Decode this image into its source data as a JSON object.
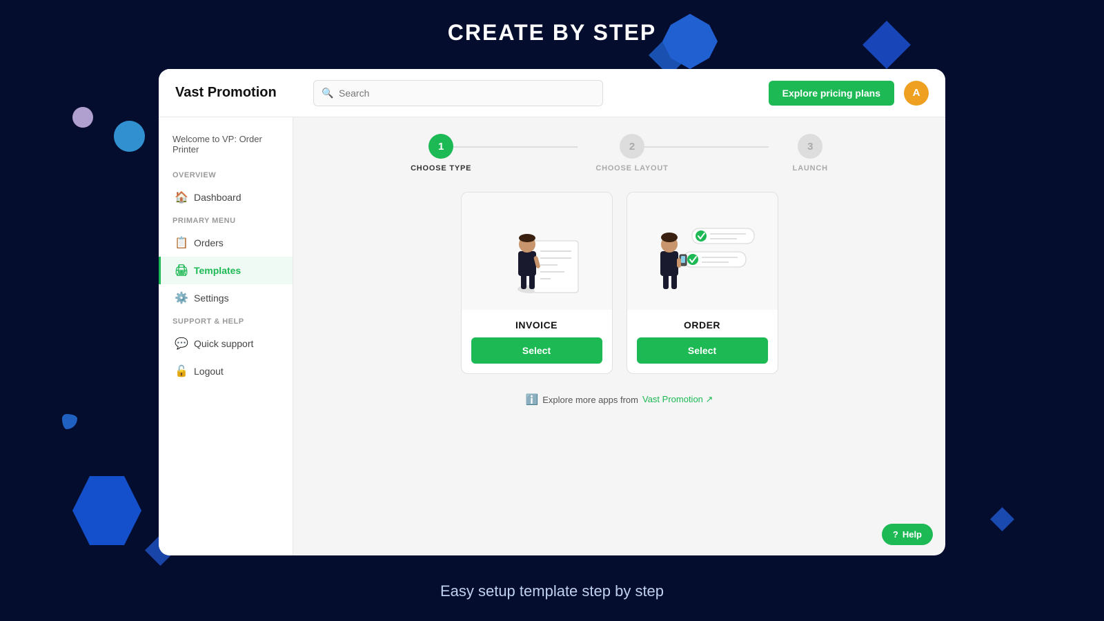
{
  "page": {
    "title": "CREATE BY STEP",
    "subtitle": "Easy setup template step by step",
    "background_color": "#050d2e"
  },
  "topbar": {
    "brand": "Vast Promotion",
    "search_placeholder": "Search",
    "explore_btn_label": "Explore pricing plans",
    "avatar_letter": "A"
  },
  "sidebar": {
    "welcome": "Welcome to VP: Order Printer",
    "sections": [
      {
        "label": "OVERVIEW",
        "items": [
          {
            "id": "dashboard",
            "label": "Dashboard",
            "icon": "🏠",
            "active": false
          }
        ]
      },
      {
        "label": "PRIMARY MENU",
        "items": [
          {
            "id": "orders",
            "label": "Orders",
            "icon": "📋",
            "active": false
          },
          {
            "id": "templates",
            "label": "Templates",
            "icon": "🖨",
            "active": true
          },
          {
            "id": "settings",
            "label": "Settings",
            "icon": "⚙️",
            "active": false
          }
        ]
      },
      {
        "label": "SUPPORT & HELP",
        "items": [
          {
            "id": "quick-support",
            "label": "Quick support",
            "icon": "💬",
            "active": false
          },
          {
            "id": "logout",
            "label": "Logout",
            "icon": "🔓",
            "active": false
          }
        ]
      }
    ]
  },
  "stepper": {
    "steps": [
      {
        "number": "1",
        "label": "CHOOSE TYPE",
        "active": true
      },
      {
        "number": "2",
        "label": "CHOOSE LAYOUT",
        "active": false
      },
      {
        "number": "3",
        "label": "LAUNCH",
        "active": false
      }
    ]
  },
  "cards": [
    {
      "id": "invoice",
      "label": "INVOICE",
      "select_btn": "Select"
    },
    {
      "id": "order",
      "label": "ORDER",
      "select_btn": "Select"
    }
  ],
  "footer": {
    "explore_text": "Explore more apps from",
    "vast_promotion_link": "Vast Promotion ↗"
  },
  "help_btn": "Help"
}
